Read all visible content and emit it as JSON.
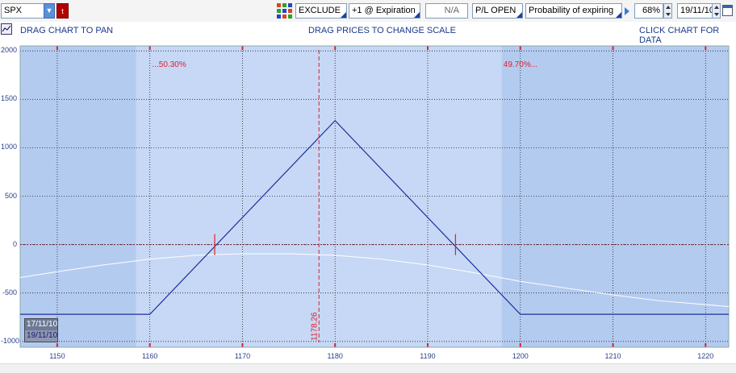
{
  "toolbar": {
    "symbol": "SPX",
    "symbol_flag": "t",
    "mode": "EXCLUDE",
    "position": "+1 @ Expiration",
    "na": "N/A",
    "pl_mode": "P/L OPEN",
    "metric": "Probability of expiring",
    "percent": "68%",
    "date": "19/11/10"
  },
  "hints": {
    "pan": "DRAG CHART TO PAN",
    "scale": "DRAG PRICES TO CHANGE SCALE",
    "data": "CLICK CHART FOR DATA"
  },
  "chart": {
    "left_prob": "...50.30%",
    "right_prob": "49.70%...",
    "current_price": "1178.26",
    "date_from": "17/11/10",
    "date_to": "19/11/10",
    "colors": {
      "outer": "#b4cbf0",
      "inner": "#c6d8f5",
      "pl_line": "#1f2f9c",
      "marker": "#e0202a",
      "prob_curve": "#ffffff"
    }
  },
  "chart_data": {
    "type": "line",
    "x_ticks": [
      1150,
      1160,
      1170,
      1180,
      1190,
      1200,
      1210,
      1220
    ],
    "y_ticks": [
      2000,
      1500,
      1000,
      500,
      0,
      -500,
      -1000
    ],
    "xlim": [
      1146,
      1222.5
    ],
    "ylim": [
      -1010,
      2010
    ],
    "series": [
      {
        "x": [
          1146,
          1160,
          1180,
          1200,
          1222.5
        ],
        "y": [
          -720,
          -720,
          1280,
          -720,
          -720
        ]
      }
    ],
    "break_even": [
      1167,
      1193
    ],
    "current_price": 1178.26,
    "probability_band": [
      1158.5,
      1198
    ],
    "probability_curve": {
      "x": [
        1146,
        1150,
        1155,
        1160,
        1165,
        1170,
        1175,
        1180,
        1185,
        1190,
        1195,
        1200,
        1205,
        1210,
        1215,
        1222.5
      ],
      "y": [
        -340,
        -280,
        -210,
        -150,
        -110,
        -95,
        -95,
        -110,
        -150,
        -210,
        -290,
        -380,
        -450,
        -520,
        -580,
        -640
      ]
    }
  }
}
